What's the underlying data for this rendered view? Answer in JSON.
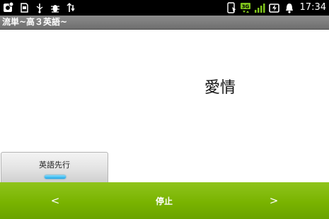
{
  "status_bar": {
    "left_icons": [
      "app-notification-icon",
      "sd-card-icon",
      "usb-icon",
      "debug-bug-icon",
      "usb-tether-icon"
    ],
    "right_icons": [
      "phone-icon",
      "3g-icon",
      "signal-icon",
      "battery-icon",
      "alarm-icon"
    ],
    "network_label": "3G",
    "time": "17:34"
  },
  "title_bar": {
    "title": "流単~高３英語~"
  },
  "main": {
    "word": "愛情"
  },
  "mode_button": {
    "label": "英語先行",
    "indicator_color": "#29a9e8"
  },
  "bottom_bar": {
    "prev_label": "<",
    "stop_label": "停止",
    "next_label": ">"
  },
  "colors": {
    "status_bar": "#000000",
    "title_bar": "#7d7d7d",
    "accent_green": "#79b300",
    "signal_green": "#7fc31c"
  }
}
